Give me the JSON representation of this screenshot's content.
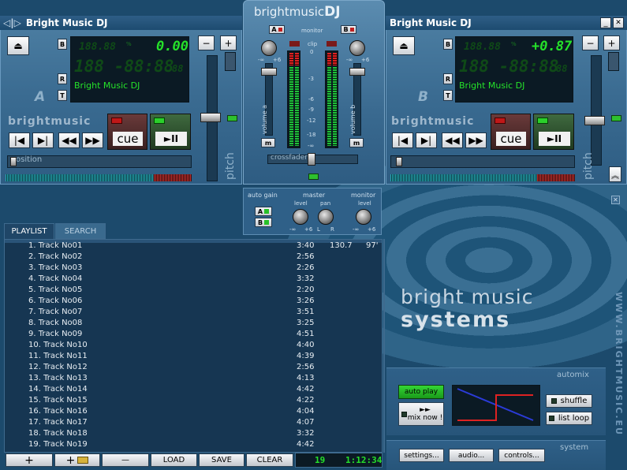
{
  "deckA": {
    "title": "Bright Music DJ",
    "bpm_dim": "188.88",
    "bpm": "0.00",
    "time_dim": "188 -88:88",
    "time_ms": "88",
    "track_text": "Bright Music DJ",
    "letter": "A",
    "brand": "brightmusic",
    "cue_label": "cue",
    "play_label": "►II",
    "position_label": "osition",
    "pitch_label": "pitch",
    "minus": "−",
    "plus": "+",
    "eject": "⏏",
    "side_buttons": [
      "B",
      "R",
      "T"
    ],
    "bpm_tag": "BPM",
    "pct_tag": "%",
    "db_tag": "dB"
  },
  "deckB": {
    "title": "Bright Music DJ",
    "bpm_dim": "188.88",
    "bpm": "+0.87",
    "time_dim": "188 -88:88",
    "time_ms": "88",
    "track_text": "Bright Music DJ",
    "letter": "B",
    "brand": "brightmusic",
    "cue_label": "cue",
    "play_label": "►II",
    "pitch_label": "pitch",
    "minus": "−",
    "plus": "+",
    "eject": "⏏",
    "min_btn": "_",
    "close_btn": "✕",
    "side_buttons": [
      "B",
      "R",
      "T"
    ],
    "bpm_tag": "BPM",
    "pct_tag": "%",
    "db_tag": "dB"
  },
  "mixer": {
    "logo_a": "brightmusic",
    "logo_b": "DJ",
    "monitor": "monitor",
    "a": "A",
    "b": "B",
    "clip": "clip",
    "vol_a": "volume a",
    "vol_b": "volume b",
    "m": "m",
    "crossfader": "crossfader",
    "scale": [
      "0",
      "-3",
      "-6",
      "-9",
      "-12",
      "-18",
      "-∞"
    ],
    "autogain": "auto gain",
    "master": "master",
    "level": "level",
    "pan": "pan",
    "monitor_lbl": "monitor",
    "knob_lo": "-∞",
    "knob_hi": "+6",
    "pan_l": "L",
    "pan_r": "R"
  },
  "playlist": {
    "tabs": [
      "PLAYLIST",
      "SEARCH"
    ],
    "rows": [
      {
        "name": "1. Track No01",
        "len": "3:40",
        "bpm": "130.7",
        "key": "97'"
      },
      {
        "name": "2. Track No02",
        "len": "2:56",
        "bpm": "",
        "key": ""
      },
      {
        "name": "3. Track No03",
        "len": "2:26",
        "bpm": "",
        "key": ""
      },
      {
        "name": "4. Track No04",
        "len": "3:32",
        "bpm": "",
        "key": ""
      },
      {
        "name": "5. Track No05",
        "len": "2:20",
        "bpm": "",
        "key": ""
      },
      {
        "name": "6. Track No06",
        "len": "3:26",
        "bpm": "",
        "key": ""
      },
      {
        "name": "7. Track No07",
        "len": "3:51",
        "bpm": "",
        "key": ""
      },
      {
        "name": "8. Track No08",
        "len": "3:25",
        "bpm": "",
        "key": ""
      },
      {
        "name": "9. Track No09",
        "len": "4:51",
        "bpm": "",
        "key": ""
      },
      {
        "name": "10. Track No10",
        "len": "4:40",
        "bpm": "",
        "key": ""
      },
      {
        "name": "11. Track No11",
        "len": "4:39",
        "bpm": "",
        "key": ""
      },
      {
        "name": "12. Track No12",
        "len": "2:56",
        "bpm": "",
        "key": ""
      },
      {
        "name": "13. Track No13",
        "len": "4:13",
        "bpm": "",
        "key": ""
      },
      {
        "name": "14. Track No14",
        "len": "4:42",
        "bpm": "",
        "key": ""
      },
      {
        "name": "15. Track No15",
        "len": "4:22",
        "bpm": "",
        "key": ""
      },
      {
        "name": "16. Track No16",
        "len": "4:04",
        "bpm": "",
        "key": ""
      },
      {
        "name": "17. Track No17",
        "len": "4:07",
        "bpm": "",
        "key": ""
      },
      {
        "name": "18. Track No18",
        "len": "3:32",
        "bpm": "",
        "key": ""
      },
      {
        "name": "19. Track No19",
        "len": "4:42",
        "bpm": "",
        "key": ""
      }
    ],
    "btn_add": "+",
    "btn_add_folder": "+",
    "btn_remove": "—",
    "btn_load": "LOAD",
    "btn_save": "SAVE",
    "btn_clear": "CLEAR",
    "count": "19",
    "total": "1:12:34"
  },
  "branding": {
    "line1": "bright music",
    "line2": "systems",
    "url": "WWW.BRIGHTMUSIC.EU"
  },
  "automix": {
    "title": "automix",
    "autoplay": "auto play",
    "mixnow_arrow": "►►",
    "mixnow": "mix now !",
    "shuffle": "shuffle",
    "listloop": "list loop"
  },
  "system": {
    "title": "system",
    "settings": "settings...",
    "audio": "audio...",
    "controls": "controls..."
  },
  "close_panel": "✕"
}
